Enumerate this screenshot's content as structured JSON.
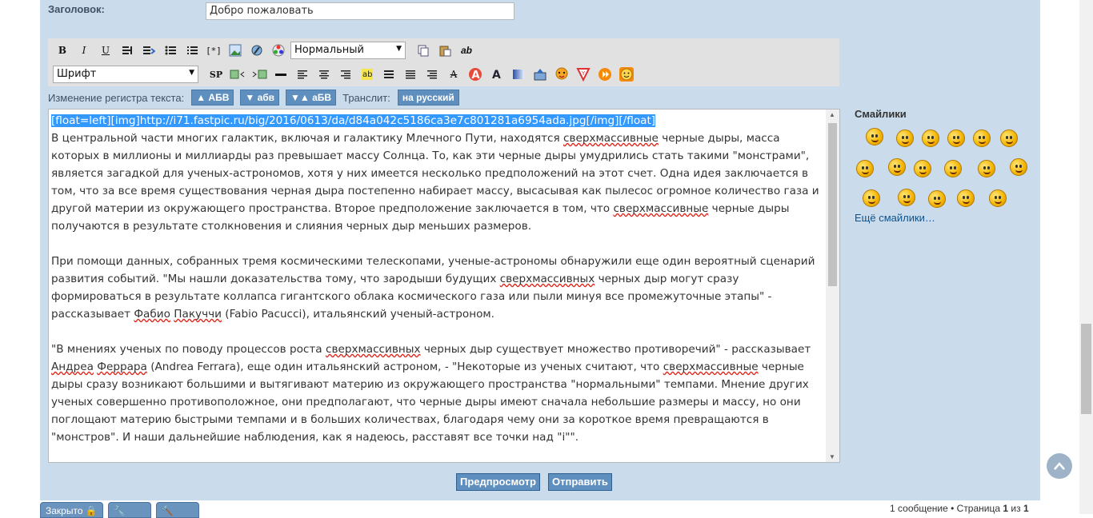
{
  "form": {
    "title_label": "Заголовок:",
    "title_value": "Добро пожаловать"
  },
  "toolbar1": {
    "bold": "B",
    "italic": "I",
    "underline": "U",
    "paragraph_select": "Нормальный",
    "icons": [
      "bold-icon",
      "italic-icon",
      "underline-icon",
      "quote-icon",
      "code-icon",
      "bullet-list-icon",
      "numbered-list-icon",
      "list-item-icon",
      "image-icon",
      "link-icon",
      "color-icon",
      "copy-icon",
      "paste-icon",
      "spellcheck-icon"
    ]
  },
  "toolbar2": {
    "font_select": "Шрифт",
    "sp_label": "SP",
    "icons": [
      "spoiler-icon",
      "image-left-icon",
      "image-right-icon",
      "horizontal-rule-icon",
      "align-left-icon",
      "align-center-icon",
      "align-right-icon",
      "highlight-icon",
      "justify-icon",
      "indent-icon",
      "outdent-icon",
      "strike-icon",
      "font-size-icon",
      "font-color-icon",
      "background-icon",
      "upload-icon",
      "chat-icon",
      "youtube-icon",
      "media-icon",
      "smiley-box-icon"
    ]
  },
  "case_bar": {
    "label": "Изменение регистра текста:",
    "upper": "▲ АБВ",
    "lower": "▼ абв",
    "toggle": "▼▲ аБВ",
    "translit_label": "Транслит:",
    "translit_btn": "на русский"
  },
  "editor": {
    "line1": "[float=left][img]http://i71.fastpic.ru/big/2016/0613/da/d84a042c5186ca3e7c801281a6954ada.jpg[/img][/float]",
    "p1": [
      {
        "t": "В центральной части многих галактик, включая и галактику Млечного Пути, находятся "
      },
      {
        "t": "сверхмассивные",
        "sp": true
      },
      {
        "t": " черные дыры, масса которых в миллионы и миллиарды раз превышает массу Солнца. То, как эти черные дыры умудрились стать такими \"монстрами\", является загадкой для ученых-астрономов, хотя у них имеется несколько предположений на этот счет. Одна идея заключается в том, что за все время существования черная дыра постепенно набирает массу, высасывая как пылесос огромное количество газа и другой материи из окружающего пространства. Второе предположение заключается в том, что "
      },
      {
        "t": "сверхмассивные",
        "sp": true
      },
      {
        "t": " черные дыры получаются в результате столкновения и слияния черных дыр меньших размеров."
      }
    ],
    "p2": [
      {
        "t": "При помощи данных, собранных тремя космическими телескопами, ученые-астрономы обнаружили еще один вероятный сценарий развития событий. \"Мы нашли доказательства тому, что зародыши будущих "
      },
      {
        "t": "сверхмассивных",
        "sp": true
      },
      {
        "t": " черных дыр могут сразу формироваться в результате коллапса гигантского облака космического газа или пыли минуя все промежуточные этапы\" - рассказывает "
      },
      {
        "t": "Фабио",
        "sp": true
      },
      {
        "t": " "
      },
      {
        "t": "Пакуччи",
        "sp": true
      },
      {
        "t": " (Fabio Pacucci), итальянский ученый-астроном."
      }
    ],
    "p3": [
      {
        "t": "\"В мнениях ученых по поводу процессов роста "
      },
      {
        "t": "сверхмассивных",
        "sp": true
      },
      {
        "t": " черных дыр существует множество противоречий\" - рассказывает "
      },
      {
        "t": "Андреа",
        "sp": true
      },
      {
        "t": " "
      },
      {
        "t": "Феррара",
        "sp": true
      },
      {
        "t": " (Andrea Ferrara), еще один итальянский астроном, - \"Некоторые из ученых считают, что "
      },
      {
        "t": "сверхмассивные",
        "sp": true
      },
      {
        "t": " черные дыры сразу возникают большими и вытягивают материю из окружающего пространства \"нормальными\" темпами. Мнение других ученых совершенно противоположное, они предполагают, что черные дыры имеют сначала небольшие размеры и массу, но они поглощают материю быстрыми темпами и в больших количествах, благодаря чему они за короткое время превращаются в \"монстров\". И наши дальнейшие наблюдения, как я надеюсь, расставят все точки над \"i\"\"."
      }
    ]
  },
  "smilies": {
    "title": "Смайлики",
    "more": "Ещё смайлики…"
  },
  "buttons": {
    "preview": "Предпросмотр",
    "submit": "Отправить"
  },
  "bottom": {
    "tab1": "Закрыто",
    "page_info_pre": "1 сообщение • Страница ",
    "page_cur": "1",
    "page_mid": " из ",
    "page_total": "1"
  }
}
